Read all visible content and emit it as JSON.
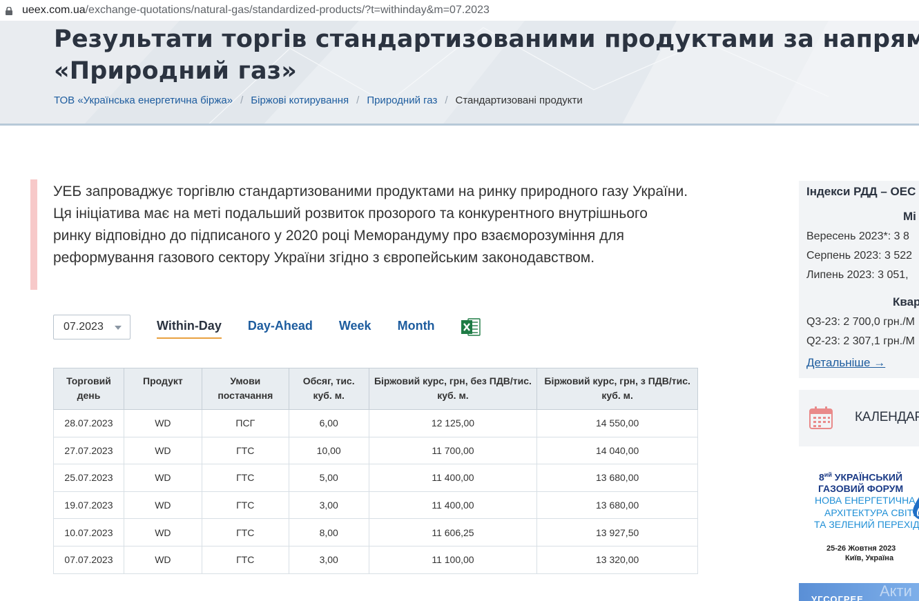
{
  "browser": {
    "url_host": "ueex.com.ua",
    "url_path": "/exchange-quotations/natural-gas/standardized-products/?t=withinday&m=07.2023"
  },
  "header": {
    "title_line1": "Результати торгів стандартизованими продуктами за напрямком",
    "title_line2": "«Природний газ»",
    "breadcrumbs": [
      "ТОВ «Українська енергетична біржа»",
      "Біржові котирування",
      "Природний газ",
      "Стандартизовані продукти"
    ]
  },
  "intro": {
    "text": "УЕБ запроваджує торгівлю стандартизованими продуктами на ринку природного газу України. Ця ініціатива має на меті подальший розвиток прозорого та конкурентного внутрішнього ринку відповідно до підписаного у 2020 році Меморандуму про взаєморозуміння для реформування газового сектору України згідно з європейським законодавством."
  },
  "controls": {
    "month_select": "07.2023",
    "tabs": [
      "Within-Day",
      "Day-Ahead",
      "Week",
      "Month"
    ],
    "active_tab": "Within-Day",
    "excel_icon": "excel-icon"
  },
  "table": {
    "headers": [
      "Торговий день",
      "Продукт",
      "Умови постачання",
      "Обсяг, тис. куб. м.",
      "Біржовий курс, грн, без ПДВ/тис. куб. м.",
      "Біржовий курс, грн, з ПДВ/тис. куб. м."
    ],
    "rows": [
      [
        "28.07.2023",
        "WD",
        "ПСГ",
        "6,00",
        "12 125,00",
        "14 550,00"
      ],
      [
        "27.07.2023",
        "WD",
        "ГТС",
        "10,00",
        "11 700,00",
        "14 040,00"
      ],
      [
        "25.07.2023",
        "WD",
        "ГТС",
        "5,00",
        "11 400,00",
        "13 680,00"
      ],
      [
        "19.07.2023",
        "WD",
        "ГТС",
        "3,00",
        "11 400,00",
        "13 680,00"
      ],
      [
        "10.07.2023",
        "WD",
        "ГТС",
        "8,00",
        "11 606,25",
        "13 927,50"
      ],
      [
        "07.07.2023",
        "WD",
        "ГТС",
        "3,00",
        "11 100,00",
        "13 320,00"
      ]
    ]
  },
  "sidebar": {
    "title": "Індекси РДД – ОЕС",
    "monthly_heading": "Мі",
    "monthly": [
      "Вересень 2023*: 3 8",
      "Серпень 2023: 3 522",
      "Липень 2023: 3 051,"
    ],
    "quarterly_heading": "Квар",
    "quarterly": [
      "Q3-23: 2 700,0 грн./М",
      "Q2-23: 2 307,1 грн./М"
    ],
    "more_link": "Детальніше →",
    "calendar_label": "КАЛЕНДАР",
    "forum": {
      "line1_num": "8",
      "line1_sup": "ий",
      "line1_text": " УКРАЇНСЬКИЙ",
      "line2": "ГАЗОВИЙ ФОРУМ",
      "line3": "НОВА ЕНЕРГЕТИЧНА",
      "line4": "АРХІТЕКТУРА СВІТУ",
      "line5": "ТА ЗЕЛЕНИЙ ПЕРЕХІД",
      "date": "25-26 Жовтня 2023",
      "place": "Київ, Україна"
    },
    "bottom_banner_text": "УГСОГРЕЕ",
    "watermark": "Акти"
  },
  "colors": {
    "link": "#1d5c9e",
    "active_tab_underline": "#e8a040",
    "intro_bar": "#f7c9c9",
    "table_header_bg": "#e8edf1"
  }
}
